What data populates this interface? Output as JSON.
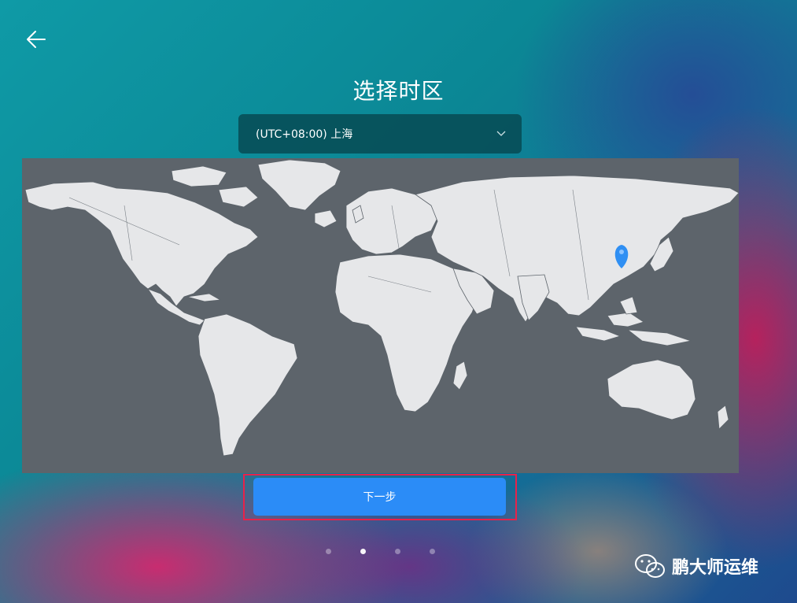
{
  "header": {
    "title": "选择时区"
  },
  "timezone": {
    "selected": "(UTC+08:00) 上海"
  },
  "icons": {
    "back": "arrow-left-icon",
    "dropdown": "chevron-down-icon",
    "marker": "location-pin-icon",
    "watermark": "wechat-icon"
  },
  "actions": {
    "next_label": "下一步"
  },
  "pager": {
    "count": 4,
    "active_index": 1
  },
  "watermark": {
    "text": "鹏大师运维"
  },
  "colors": {
    "primary": "#2b8cf7",
    "highlight_border": "#e8224a",
    "map_water": "#5d646b",
    "map_land": "#e6e7e9",
    "marker": "#2f8ff3"
  }
}
